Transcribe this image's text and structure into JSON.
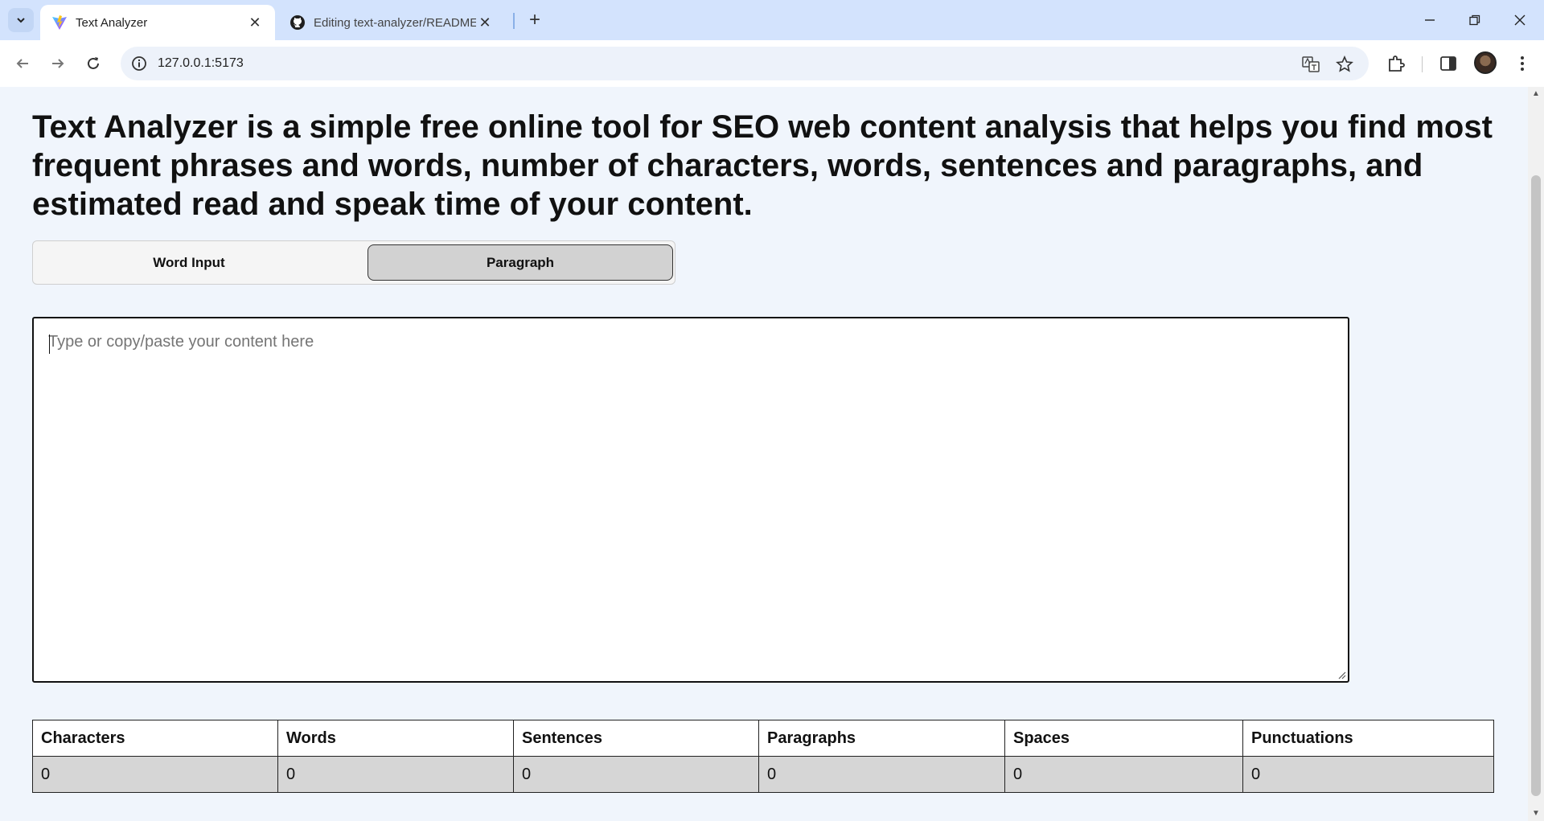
{
  "browser": {
    "tabs": [
      {
        "title": "Text Analyzer",
        "active": true
      },
      {
        "title": "Editing text-analyzer/README.md",
        "active": false
      }
    ],
    "url": "127.0.0.1:5173"
  },
  "page": {
    "headline": "Text Analyzer is a simple free online tool for SEO web content analysis that helps you find most frequent phrases and words, number of characters, words, sentences and paragraphs, and estimated read and speak time of your content.",
    "modes": {
      "word_input": "Word Input",
      "paragraph": "Paragraph",
      "selected": "Paragraph"
    },
    "textarea": {
      "placeholder": "Type or copy/paste your content here",
      "value": ""
    },
    "stats": {
      "headers": [
        "Characters",
        "Words",
        "Sentences",
        "Paragraphs",
        "Spaces",
        "Punctuations"
      ],
      "values": [
        "0",
        "0",
        "0",
        "0",
        "0",
        "0"
      ]
    }
  },
  "colors": {
    "tabstrip": "#d3e3fd",
    "page_bg": "#f0f5fc",
    "selected_mode": "#d2d2d2",
    "value_row": "#d6d6d6"
  }
}
